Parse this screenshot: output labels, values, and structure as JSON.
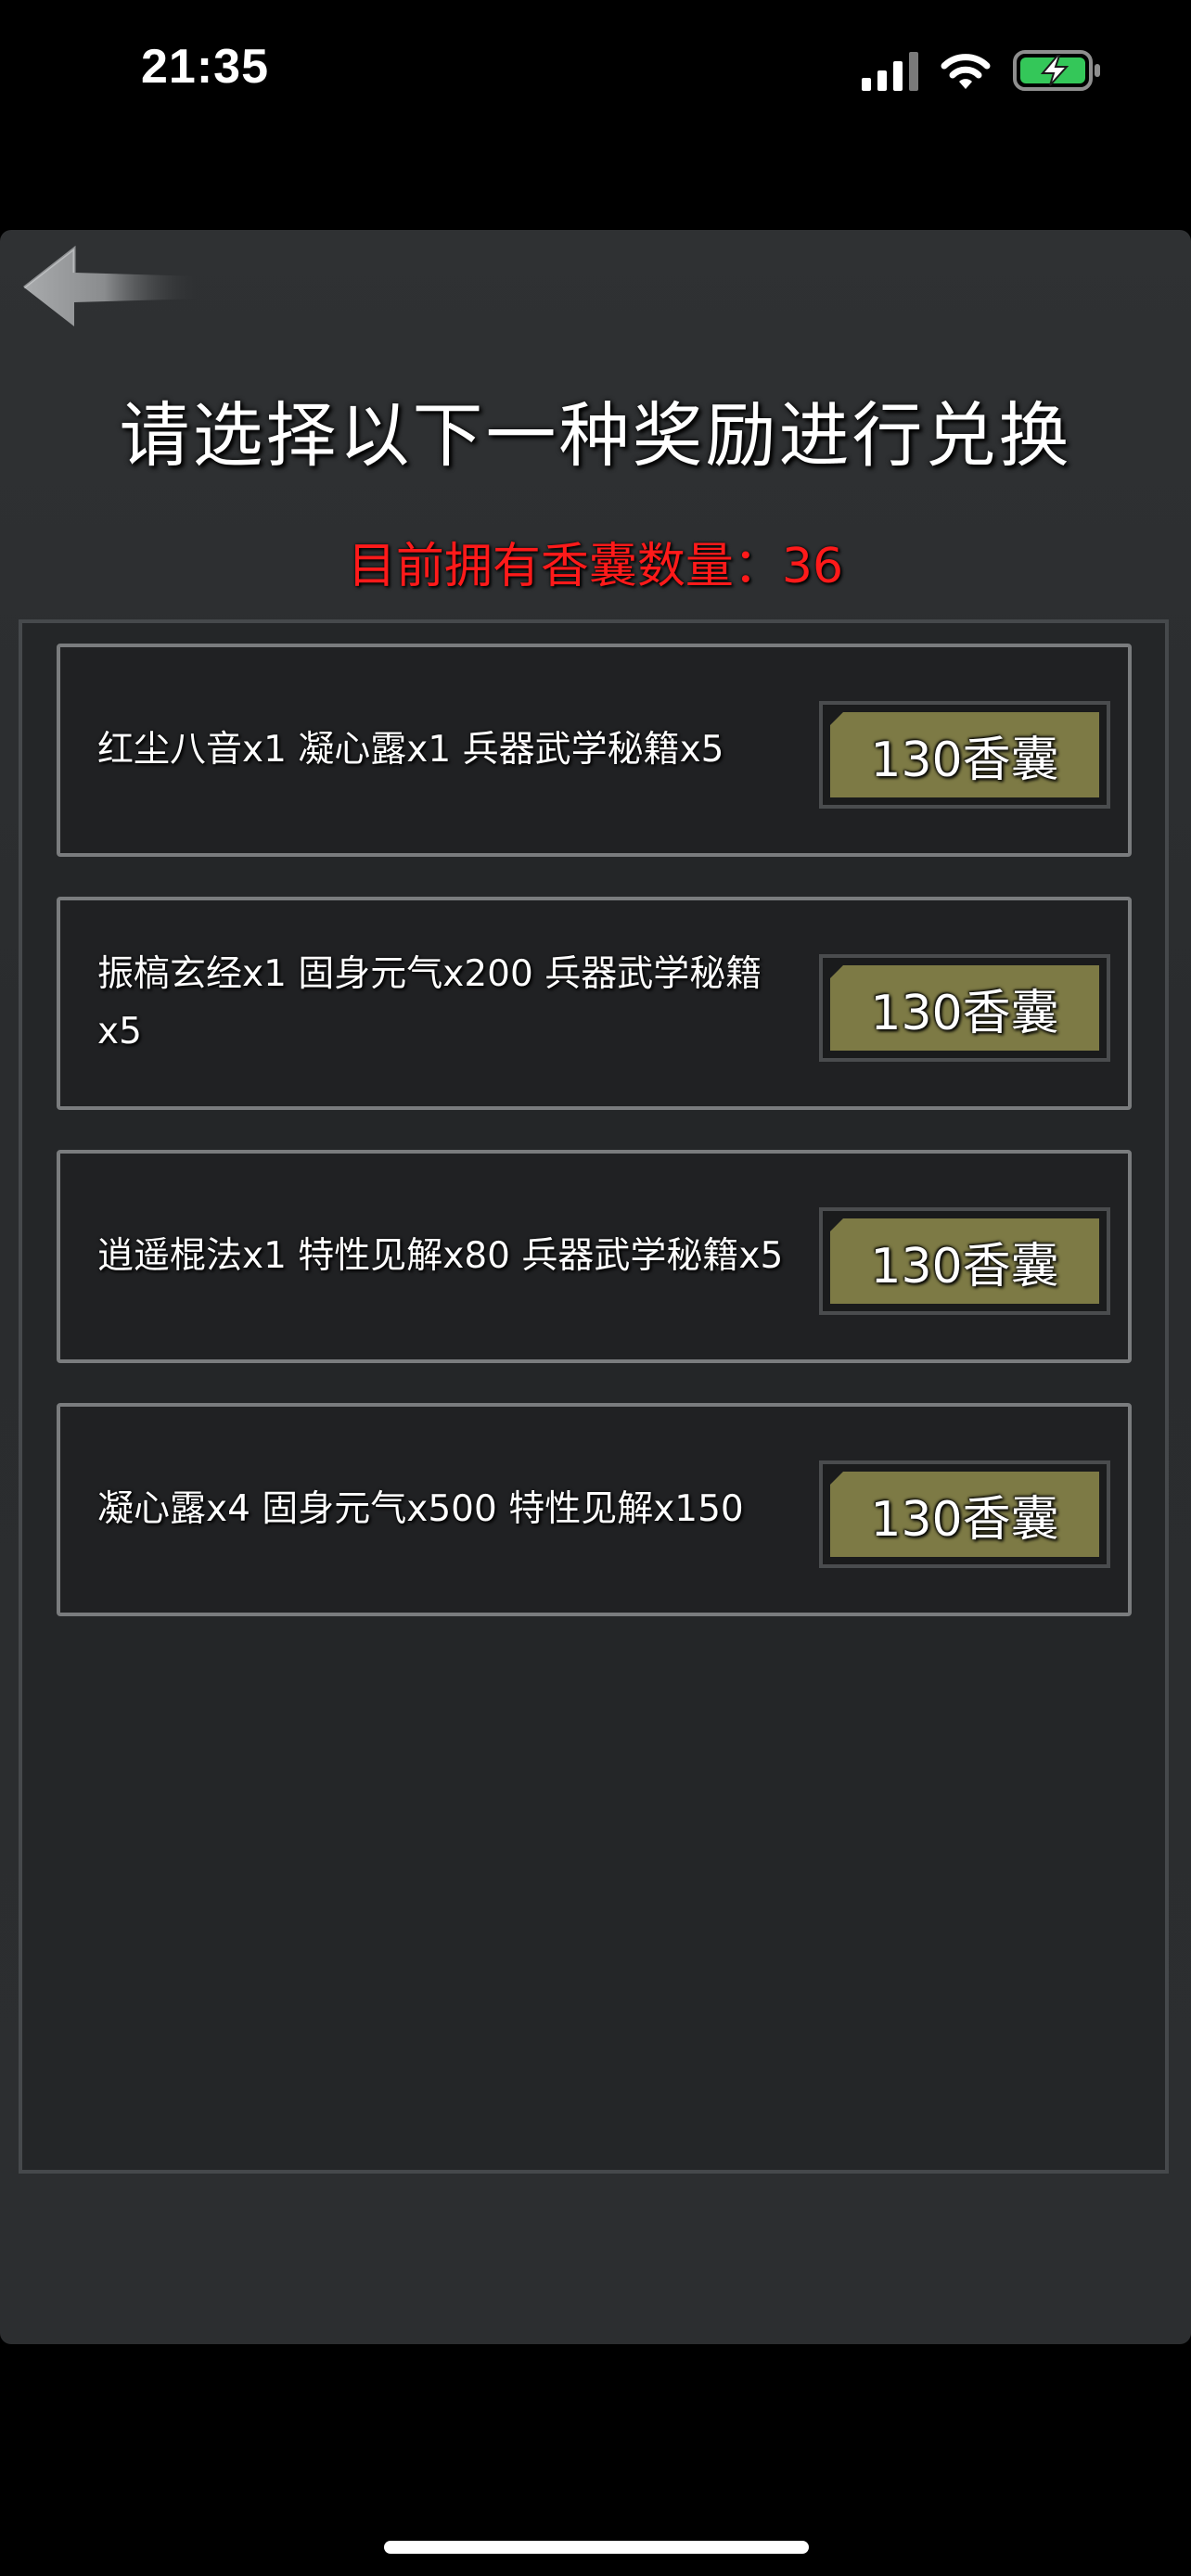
{
  "status_bar": {
    "time": "21:35"
  },
  "header": {
    "title": "请选择以下一种奖励进行兑换",
    "count_line": "目前拥有香囊数量：36"
  },
  "rewards": [
    {
      "text": "红尘八音x1 凝心露x1 兵器武学秘籍x5",
      "price": "130香囊"
    },
    {
      "text": "振槁玄经x1 固身元气x200 兵器武学秘籍x5",
      "price": "130香囊"
    },
    {
      "text": "逍遥棍法x1 特性见解x80 兵器武学秘籍x5",
      "price": "130香囊"
    },
    {
      "text": "凝心露x4 固身元气x500 特性见解x150",
      "price": "130香囊"
    }
  ],
  "icons": {
    "back": "back-arrow-icon",
    "signal": "cellular-signal-icon",
    "wifi": "wifi-icon",
    "battery": "battery-charging-icon"
  },
  "colors": {
    "count_text": "#ff1a1a",
    "price_button": "#7d7a45",
    "battery_fill": "#34c759",
    "panel": "#2c2e30"
  }
}
